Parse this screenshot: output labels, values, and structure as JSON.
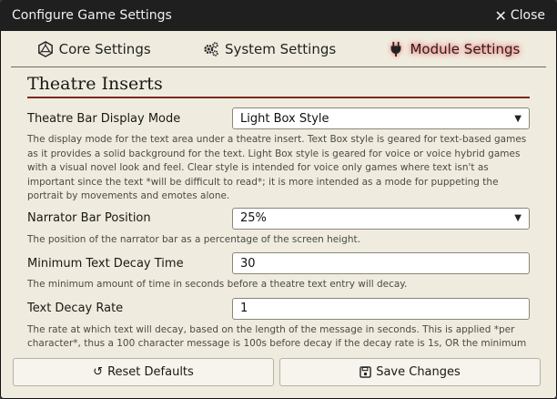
{
  "window": {
    "title": "Configure Game Settings",
    "close_label": "Close"
  },
  "tabs": [
    {
      "label": "Core Settings",
      "icon": "d20-icon"
    },
    {
      "label": "System Settings",
      "icon": "cogs-icon"
    },
    {
      "label": "Module Settings",
      "icon": "plug-icon",
      "active": true
    }
  ],
  "section": {
    "title": "Theatre Inserts"
  },
  "settings": [
    {
      "label": "Theatre Bar Display Mode",
      "value": "Light Box Style",
      "type": "select",
      "hint": "The display mode for the text area under a theatre insert. Text Box style is geared for text-based games as it provides a solid background for the text. Light Box style is geared for voice or voice hybrid games with a visual novel look and feel. Clear style is intended for voice only games where text isn't as important since the text *will be difficult to read*; it is more intended as a mode for puppeting the portrait by movements and emotes alone."
    },
    {
      "label": "Narrator Bar Position",
      "value": "25%",
      "type": "select",
      "hint": "The position of the narrator bar as a percentage of the screen height."
    },
    {
      "label": "Minimum Text Decay Time",
      "value": "30",
      "type": "number",
      "hint": "The minimum amount of time in seconds before a theatre text entry will decay."
    },
    {
      "label": "Text Decay Rate",
      "value": "1",
      "type": "number",
      "hint": "The rate at which text will decay, based on the length of the message in seconds. This is applied *per character*, thus a 100 character message is 100s before decay if the decay rate is 1s, OR the minimum decay time, whichever is greater."
    }
  ],
  "footer": {
    "reset_label": "Reset Defaults",
    "save_label": "Save Changes"
  },
  "colors": {
    "titlebar": "#1f1f1f",
    "background": "#efecdf",
    "accent": "#7a2a20",
    "active_glow": "#ff5d5d"
  }
}
